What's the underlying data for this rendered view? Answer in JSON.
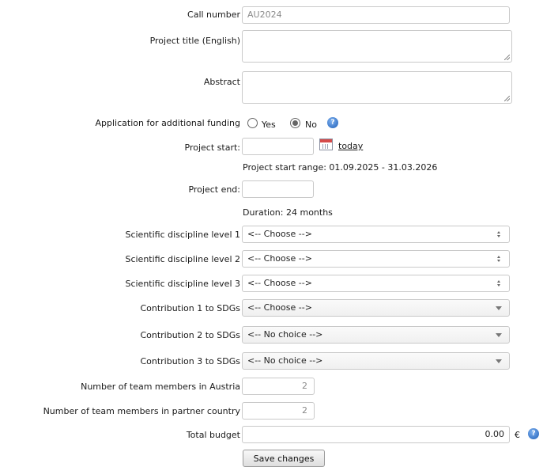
{
  "form": {
    "call_number": {
      "label": "Call number",
      "value": "AU2024"
    },
    "project_title": {
      "label": "Project title (English)",
      "value": ""
    },
    "abstract": {
      "label": "Abstract",
      "value": ""
    },
    "additional_funding": {
      "label": "Application for additional funding",
      "yes": "Yes",
      "no": "No",
      "selected": "No"
    },
    "project_start": {
      "label": "Project start:",
      "value": "",
      "today_link": "today",
      "range_note": "Project start range: 01.09.2025 - 31.03.2026"
    },
    "project_end": {
      "label": "Project end:",
      "value": "",
      "duration_note": "Duration: 24 months"
    },
    "discipline_1": {
      "label": "Scientific discipline level 1",
      "value": "<-- Choose -->"
    },
    "discipline_2": {
      "label": "Scientific discipline level 2",
      "value": "<-- Choose -->"
    },
    "discipline_3": {
      "label": "Scientific discipline level 3",
      "value": "<-- Choose -->"
    },
    "sdg_1": {
      "label": "Contribution 1 to SDGs",
      "value": "<-- Choose -->"
    },
    "sdg_2": {
      "label": "Contribution 2 to SDGs",
      "value": "<-- No choice -->"
    },
    "sdg_3": {
      "label": "Contribution 3 to SDGs",
      "value": "<-- No choice -->"
    },
    "team_austria": {
      "label": "Number of team members in Austria",
      "value": "2"
    },
    "team_partner": {
      "label": "Number of team members in partner country",
      "value": "2"
    },
    "total_budget": {
      "label": "Total budget",
      "value": "0.00",
      "currency": "€"
    },
    "save_label": "Save changes"
  },
  "icons": {
    "help": "help-icon",
    "calendar": "calendar-icon"
  },
  "colors": {
    "help_blue": "#1f5fb8",
    "border": "#c9c9c9"
  }
}
